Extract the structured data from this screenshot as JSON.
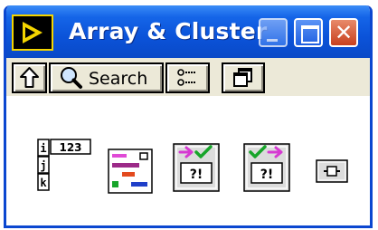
{
  "window": {
    "title": "Array & Cluster"
  },
  "title_controls": {
    "minimize_icon": "minimize-icon",
    "maximize_icon": "maximize-icon",
    "close_icon": "close-icon"
  },
  "toolbar": {
    "up_icon": "up-arrow-icon",
    "search_label": "Search",
    "options_icon": "view-options-icon",
    "restore_icon": "restore-palette-icon"
  },
  "palette": {
    "items": [
      {
        "name": "array",
        "icon": "array-icon",
        "glyph": "123",
        "indices": [
          "i",
          "j",
          "k"
        ]
      },
      {
        "name": "cluster",
        "icon": "cluster-icon"
      },
      {
        "name": "array-to-cluster",
        "icon": "array-to-cluster-icon",
        "glyph": "?!"
      },
      {
        "name": "cluster-to-array",
        "icon": "cluster-to-array-icon",
        "glyph": "?!"
      },
      {
        "name": "small-control",
        "icon": "small-control-icon"
      }
    ]
  },
  "colors": {
    "titlebar": "#0b53d9",
    "window_border": "#0b47d0",
    "close_button": "#c8401e",
    "app_icon_yellow": "#f4d500"
  }
}
